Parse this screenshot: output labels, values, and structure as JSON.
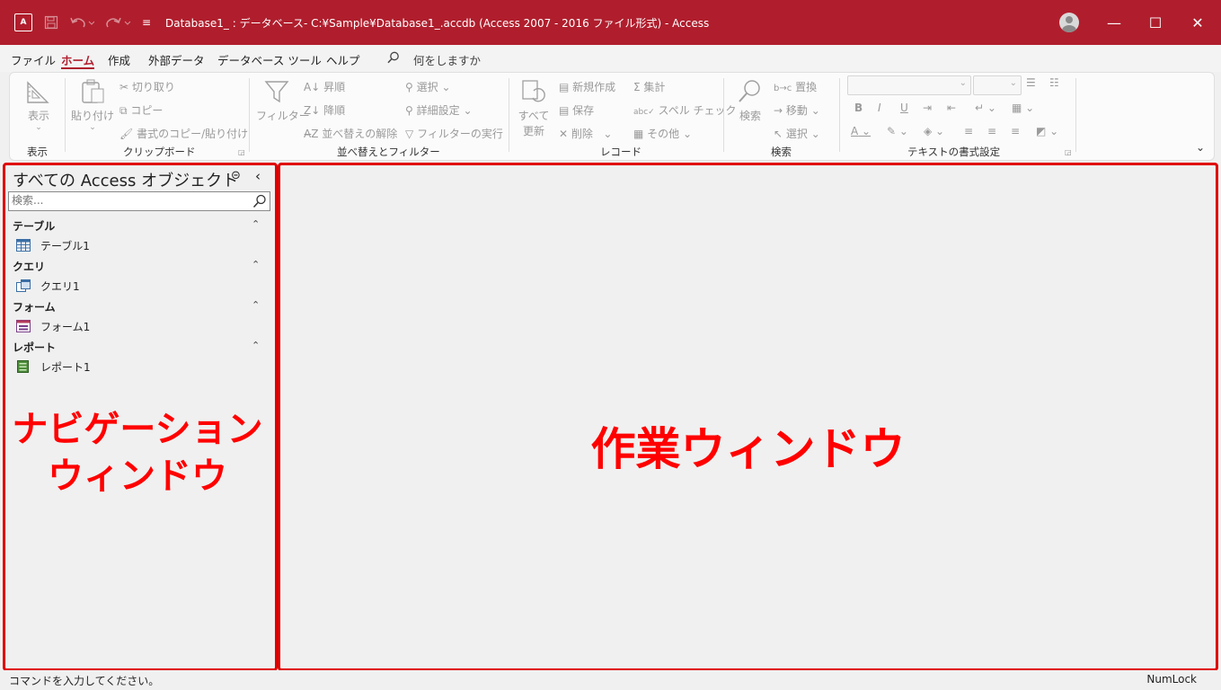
{
  "titlebar": {
    "app_icon_text": "A",
    "title": "Database1_ : データベース- C:¥Sample¥Database1_.accdb (Access 2007 - 2016 ファイル形式)  -  Access",
    "minimize": "—",
    "maximize": "☐",
    "close": "✕",
    "qat_custom": "≡"
  },
  "menu": {
    "tabs": [
      "ファイル",
      "ホーム",
      "作成",
      "外部データ",
      "データベース ツール",
      "ヘルプ"
    ],
    "active_tab": "ホーム",
    "tell_me": "何をしますか"
  },
  "ribbon": {
    "view": {
      "button": "表示",
      "label": "表示"
    },
    "clipboard": {
      "paste": "貼り付け",
      "cut": "切り取り",
      "copy": "コピー",
      "format_painter": "書式のコピー/貼り付け",
      "label": "クリップボード"
    },
    "sort_filter": {
      "filter": "フィルター",
      "ascending": "昇順",
      "descending": "降順",
      "remove_sort": "並べ替えの解除",
      "selection": "選択",
      "advanced": "詳細設定",
      "toggle_filter": "フィルターの実行",
      "label": "並べ替えとフィルター"
    },
    "records": {
      "refresh_line1": "すべて",
      "refresh_line2": "更新",
      "new": "新規作成",
      "save": "保存",
      "delete": "削除",
      "totals": "集計",
      "spelling": "スペル チェック",
      "more": "その他",
      "label": "レコード"
    },
    "find": {
      "find": "検索",
      "replace": "置換",
      "goto": "移動",
      "select": "選択",
      "label": "検索"
    },
    "text_formatting": {
      "bold": "B",
      "italic": "I",
      "underline": "U",
      "font_color": "A",
      "label": "テキストの書式設定"
    }
  },
  "nav": {
    "title": "すべての Access オブジェクト",
    "search_placeholder": "検索...",
    "groups": [
      {
        "label": "テーブル",
        "item": "テーブル1"
      },
      {
        "label": "クエリ",
        "item": "クエリ1"
      },
      {
        "label": "フォーム",
        "item": "フォーム1"
      },
      {
        "label": "レポート",
        "item": "レポート1"
      }
    ]
  },
  "annotations": {
    "nav_line1": "ナビゲーション",
    "nav_line2": "ウィンドウ",
    "work": "作業ウィンドウ"
  },
  "statusbar": {
    "message": "コマンドを入力してください。",
    "numlock": "NumLock"
  },
  "colors": {
    "accent": "#b01e2d",
    "annotation": "#ff0000",
    "frame": "#e00000"
  }
}
